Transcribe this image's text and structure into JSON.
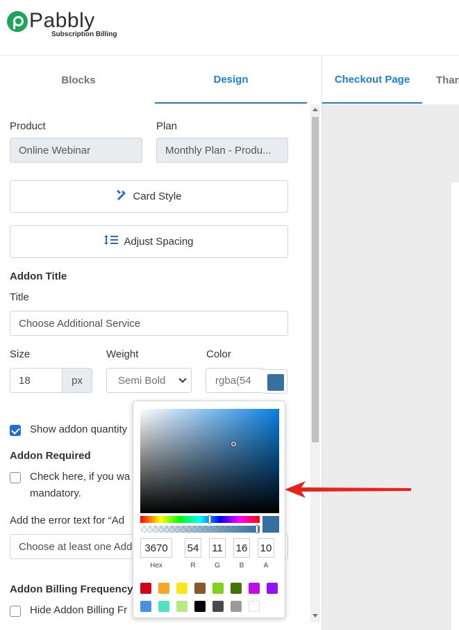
{
  "header": {
    "logo_name": "Pabbly",
    "logo_subtitle": "Subscription Billing"
  },
  "left_tabs": [
    {
      "label": "Blocks",
      "active": false
    },
    {
      "label": "Design",
      "active": true
    }
  ],
  "right_tabs": [
    {
      "label": "Checkout Page",
      "active": true
    },
    {
      "label": "Than",
      "active": false
    }
  ],
  "form": {
    "product_label": "Product",
    "product_value": "Online Webinar",
    "plan_label": "Plan",
    "plan_value": "Monthly Plan - Produ...",
    "card_style_label": "Card Style",
    "adjust_spacing_label": "Adjust Spacing",
    "addon_title_heading": "Addon Title",
    "title_label": "Title",
    "title_value": "Choose Additional Service",
    "size_label": "Size",
    "size_value": "18",
    "size_unit": "px",
    "weight_label": "Weight",
    "weight_value": "Semi Bold",
    "color_label": "Color",
    "color_value": "rgba(54",
    "show_quantity_label": "Show addon quantity",
    "show_quantity_checked": true,
    "addon_required_heading": "Addon Required",
    "required_check_label_line1": "Check here, if you wa",
    "required_check_label_line2": "mandatory.",
    "required_checked": false,
    "error_text_label": "Add the error text for “Ad",
    "error_text_value": "Choose at least one Add",
    "billing_freq_heading": "Addon Billing Frequency T",
    "hide_billing_label": "Hide Addon Billing Fr",
    "hide_billing_checked": false
  },
  "color_picker": {
    "current_color": "#3670a0",
    "hex_value": "3670",
    "hex_label": "Hex",
    "r_value": "54",
    "r_label": "R",
    "g_value": "11",
    "g_label": "G",
    "b_value": "16",
    "b_label": "B",
    "a_value": "10",
    "a_label": "A",
    "presets": [
      "#d0021b",
      "#f5a623",
      "#f8e71c",
      "#8b572a",
      "#7ed321",
      "#417505",
      "#bd10e0",
      "#9013fe",
      "#4a90e2",
      "#50e3c2",
      "#b8e986",
      "#000000",
      "#4a4a4a",
      "#9b9b9b",
      "#ffffff"
    ]
  },
  "colors": {
    "accent": "#1e7fd6",
    "brand_green": "#1fa45b",
    "arrow_red": "#e8221b"
  },
  "icons": {
    "card_style": "brush-ruler-icon",
    "adjust_spacing": "line-spacing-icon"
  }
}
